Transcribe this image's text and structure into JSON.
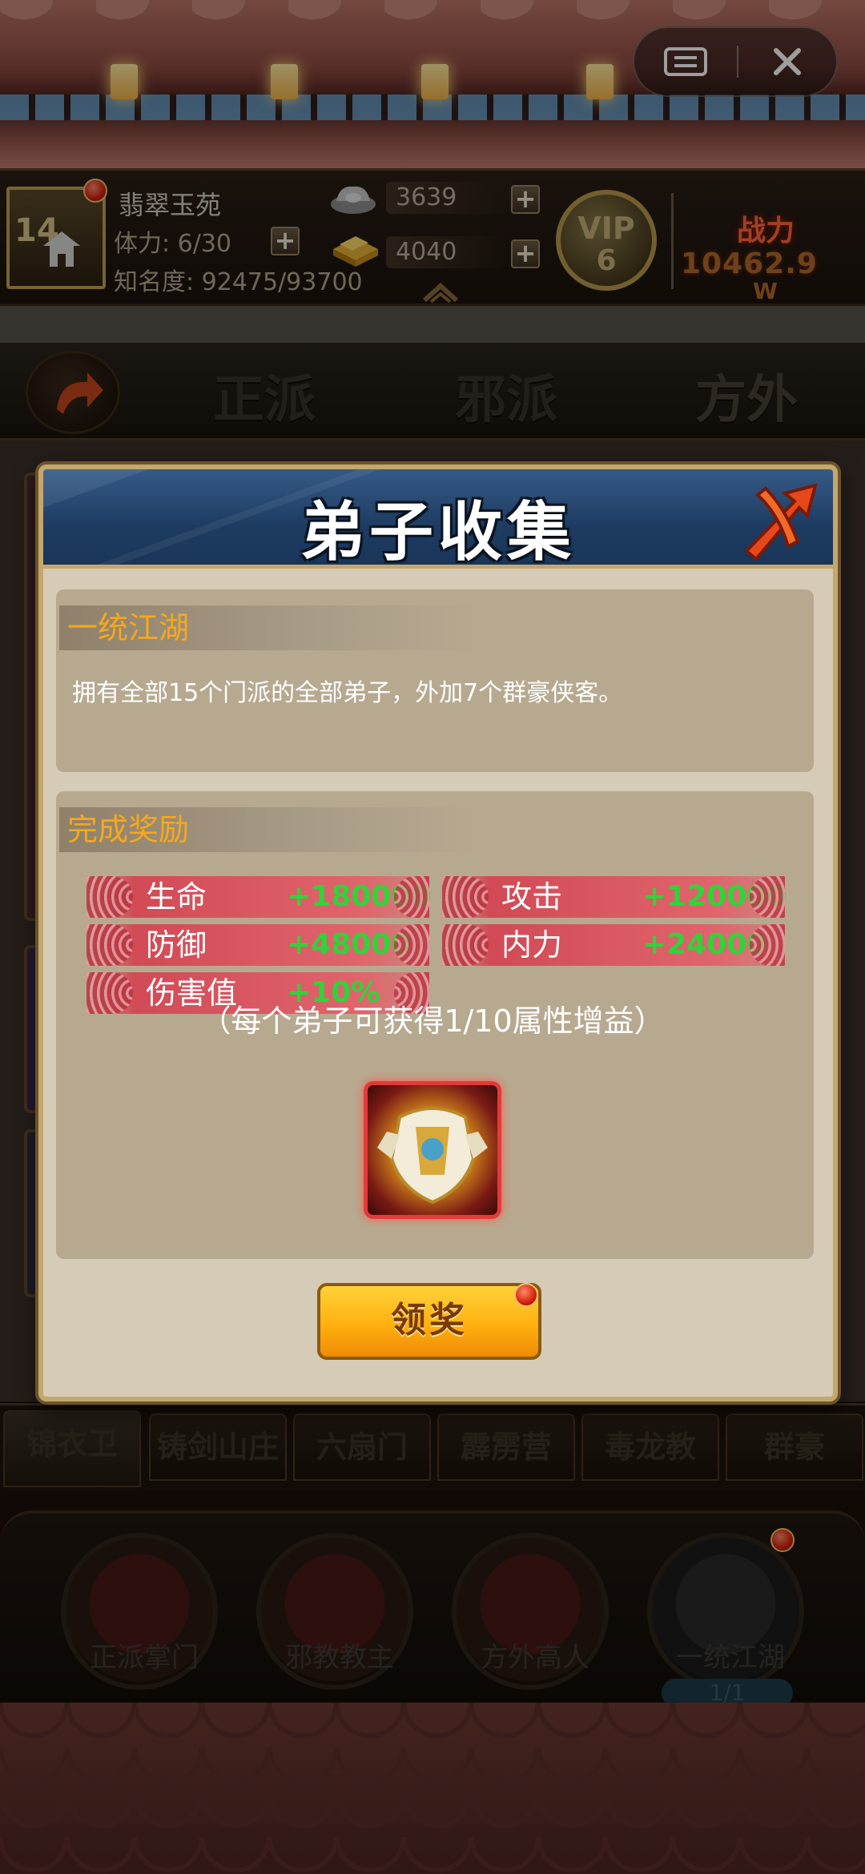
{
  "top_bar": {
    "menu_icon": "ticket-menu-icon",
    "close_icon": "close-icon"
  },
  "player": {
    "level": "14",
    "name": "翡翠玉苑",
    "stamina": "体力: 6/30",
    "fame": "知名度: 92475/93700",
    "silver": "3639",
    "gold": "4040",
    "vip_label": "VIP",
    "vip_level": "6",
    "power_label": "战力",
    "power_value": "10462.9",
    "power_unit": "W"
  },
  "factions": {
    "tabs": [
      "正派",
      "邪派",
      "方外"
    ],
    "active": 2
  },
  "modal": {
    "title": "弟子收集",
    "section1_title": "一统江湖",
    "section1_desc": "拥有全部15个门派的全部弟子，外加7个群豪侠客。",
    "section2_title": "完成奖励",
    "stats": [
      {
        "name": "生命",
        "value": "+180000"
      },
      {
        "name": "攻击",
        "value": "+120000"
      },
      {
        "name": "防御",
        "value": "+48000"
      },
      {
        "name": "内力",
        "value": "+24000"
      },
      {
        "name": "伤害值",
        "value": "+10%"
      }
    ],
    "note": "（每个弟子可获得1/10属性增益）",
    "claim_label": "领奖"
  },
  "school_tabs": [
    "锦衣卫",
    "铸剑山庄",
    "六扇门",
    "霹雳营",
    "毒龙教",
    "群豪"
  ],
  "masters": [
    {
      "label": "正派掌门"
    },
    {
      "label": "邪教教主"
    },
    {
      "label": "方外高人"
    },
    {
      "label": "一统江湖",
      "count": "1/1"
    }
  ],
  "colors": {
    "modal_header": "#1e3c62",
    "modal_body": "#d6cbb6",
    "stat_value_green": "#2fd33a",
    "section_title_orange": "#f6a81c",
    "claim_button": "#ffb00f"
  }
}
